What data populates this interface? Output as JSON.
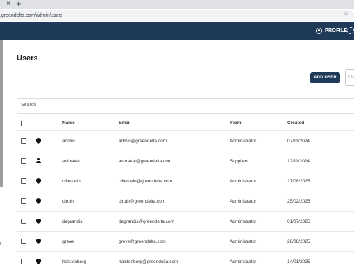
{
  "browser": {
    "tab_close": "×",
    "new_tab": "+",
    "url": "a.greendelta.com/admin/users",
    "star": "☆"
  },
  "header": {
    "profile_label": "PROFILE",
    "accent_color": "#1f3a58"
  },
  "page": {
    "title": "Users",
    "add_user_label": "ADD USER",
    "user_filter_placeholder": "Us",
    "search_placeholder": "Search"
  },
  "table": {
    "columns": [
      "Name",
      "Email",
      "Team",
      "Created"
    ],
    "rows": [
      {
        "icon": "shield-icon",
        "name": "admin",
        "email": "admin@greendelta.com",
        "team": "Administrator",
        "created": "07/11/2024"
      },
      {
        "icon": "person-icon",
        "name": "ashrakat",
        "email": "ashrakat@greendelta.com",
        "team": "Suppliers",
        "created": "12/11/2024"
      },
      {
        "icon": "shield-icon",
        "name": "cilleruelo",
        "email": "cilleruelo@greendelta.com",
        "team": "Administrator",
        "created": "27/08/2025"
      },
      {
        "icon": "shield-icon",
        "name": "ciroth",
        "email": "ciroth@greendelta.com",
        "team": "Administrator",
        "created": "25/02/2025"
      },
      {
        "icon": "shield-icon",
        "name": "degrandis",
        "email": "degrandis@greendelta.com",
        "team": "Administrator",
        "created": "01/07/2025"
      },
      {
        "icon": "shield-icon",
        "name": "greve",
        "email": "greve@greendelta.com",
        "team": "Administrator",
        "created": "28/08/2025"
      },
      {
        "icon": "shield-icon",
        "name": "halstenberg",
        "email": "halstenberg@greendelta.com",
        "team": "Administrator",
        "created": "14/01/2025"
      }
    ]
  },
  "sidebar": {
    "caret": "r"
  }
}
